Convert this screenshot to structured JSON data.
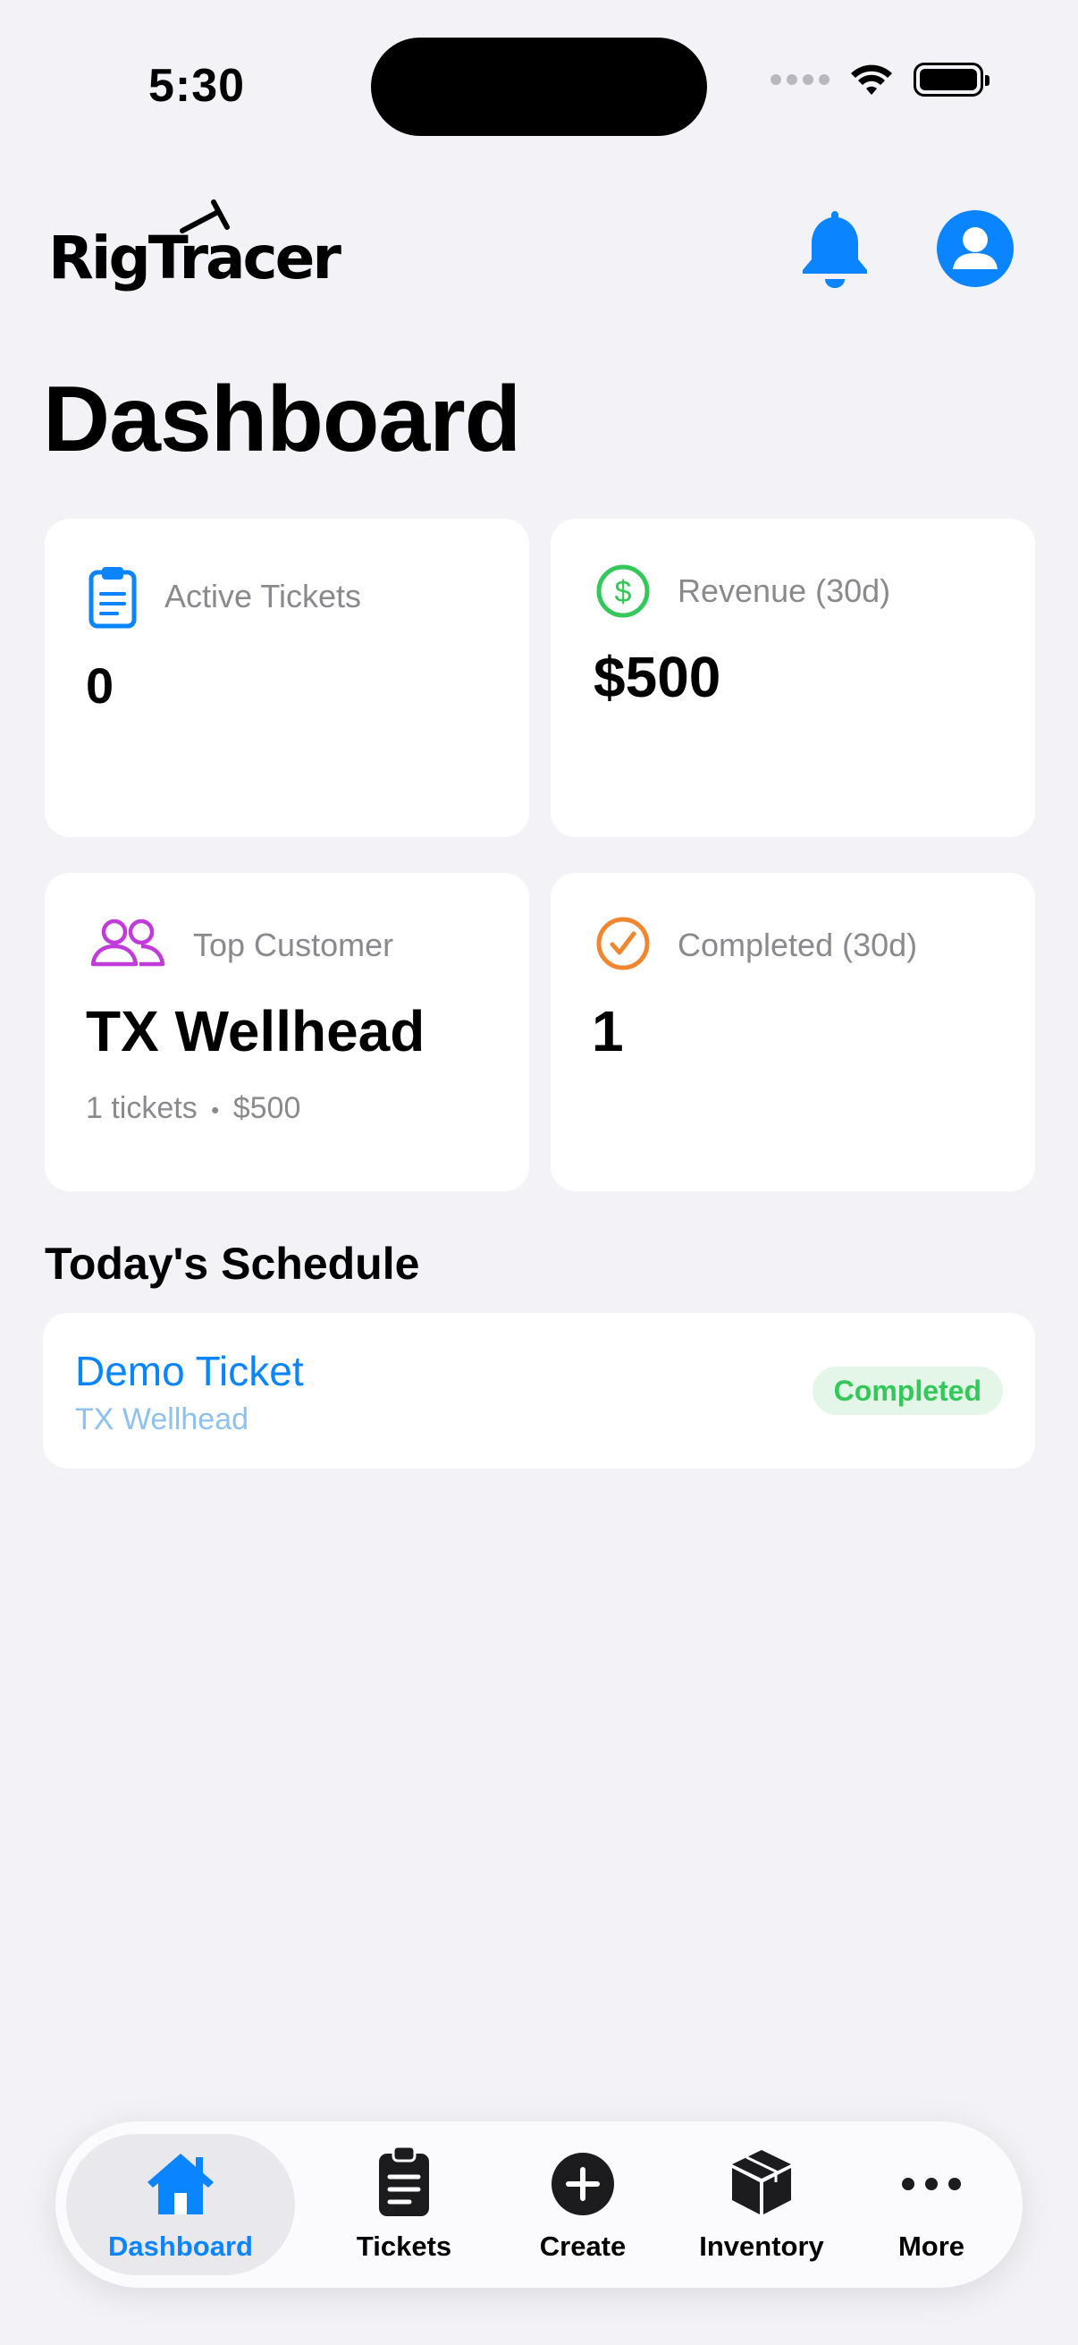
{
  "status_bar": {
    "time": "5:30"
  },
  "header": {
    "logo_text": "RigTracer",
    "page_title": "Dashboard"
  },
  "cards": {
    "active_tickets": {
      "label": "Active Tickets",
      "value": "0",
      "icon": "clipboard-icon",
      "color": "#0a84ff"
    },
    "revenue": {
      "label": "Revenue (30d)",
      "value": "$500",
      "icon": "dollar-circle-icon",
      "color": "#34c759"
    },
    "top_customer": {
      "label": "Top Customer",
      "value": "TX Wellhead",
      "sub_tickets": "1 tickets",
      "sub_sep": "•",
      "sub_amount": "$500",
      "icon": "people-icon",
      "color": "#c03bd9"
    },
    "completed": {
      "label": "Completed (30d)",
      "value": "1",
      "icon": "checkmark-circle-icon",
      "color": "#f2862f"
    }
  },
  "schedule": {
    "section_title": "Today's Schedule",
    "items": [
      {
        "title": "Demo Ticket",
        "customer": "TX Wellhead",
        "status": "Completed"
      }
    ]
  },
  "tabbar": {
    "items": [
      {
        "label": "Dashboard",
        "icon": "house-icon",
        "active": true
      },
      {
        "label": "Tickets",
        "icon": "clipboard-icon",
        "active": false
      },
      {
        "label": "Create",
        "icon": "plus-circle-icon",
        "active": false
      },
      {
        "label": "Inventory",
        "icon": "box-icon",
        "active": false
      },
      {
        "label": "More",
        "icon": "ellipsis-icon",
        "active": false
      }
    ]
  }
}
